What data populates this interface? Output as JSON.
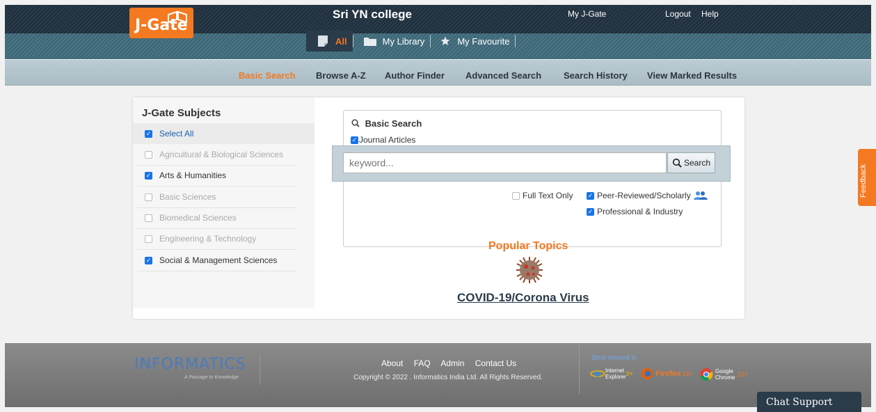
{
  "header": {
    "logo_text": "J-Gate",
    "college": "Sri YN college",
    "links": {
      "my_jgate": "My J-Gate",
      "logout": "Logout",
      "help": "Help"
    },
    "tabs": [
      {
        "label": "All",
        "icon": "document-icon"
      },
      {
        "label": "My Library",
        "icon": "folder-icon"
      },
      {
        "label": "My Favourite",
        "icon": "star-icon"
      }
    ]
  },
  "subnav": [
    "Basic Search",
    "Browse A-Z",
    "Author Finder",
    "Advanced Search",
    "Search History",
    "View Marked Results"
  ],
  "sidebar": {
    "title": "J-Gate Subjects",
    "items": [
      {
        "label": "Select All",
        "checked": true
      },
      {
        "label": "Agricultural & Biological Sciences",
        "checked": false
      },
      {
        "label": "Arts & Humanities",
        "checked": true
      },
      {
        "label": "Basic Sciences",
        "checked": false
      },
      {
        "label": "Biomedical Sciences",
        "checked": false
      },
      {
        "label": "Engineering & Technology",
        "checked": false
      },
      {
        "label": "Social & Management Sciences",
        "checked": true
      }
    ]
  },
  "search": {
    "title": "Basic Search",
    "journal_articles": "Journal Articles",
    "placeholder": "keyword...",
    "button": "Search",
    "full_text_only": "Full Text Only",
    "peer_reviewed": "Peer-Reviewed/Scholarly",
    "professional": "Professional & Industry"
  },
  "popular": {
    "title": "Popular Topics",
    "topic": "COVID-19/Corona Virus"
  },
  "footer": {
    "logo": "INFORMATICS",
    "tagline": "A Passage to Knowledge",
    "links": [
      "About",
      "FAQ",
      "Admin",
      "Contact Us"
    ],
    "copyright": "Copyright © 2022 . Informatics India Ltd. All Rights Reserved.",
    "best_viewed": "Best viewed in",
    "browsers": [
      {
        "name": "Internet Explorer",
        "version": "9+"
      },
      {
        "name": "Firefox",
        "version": "16+"
      },
      {
        "name": "Google Chrome",
        "version": "22+"
      }
    ]
  },
  "feedback": "Feedback",
  "chat": "Chat Support",
  "colors": {
    "accent": "#f47920",
    "dark": "#2a3b4a",
    "checkbox": "#1a73e8"
  }
}
